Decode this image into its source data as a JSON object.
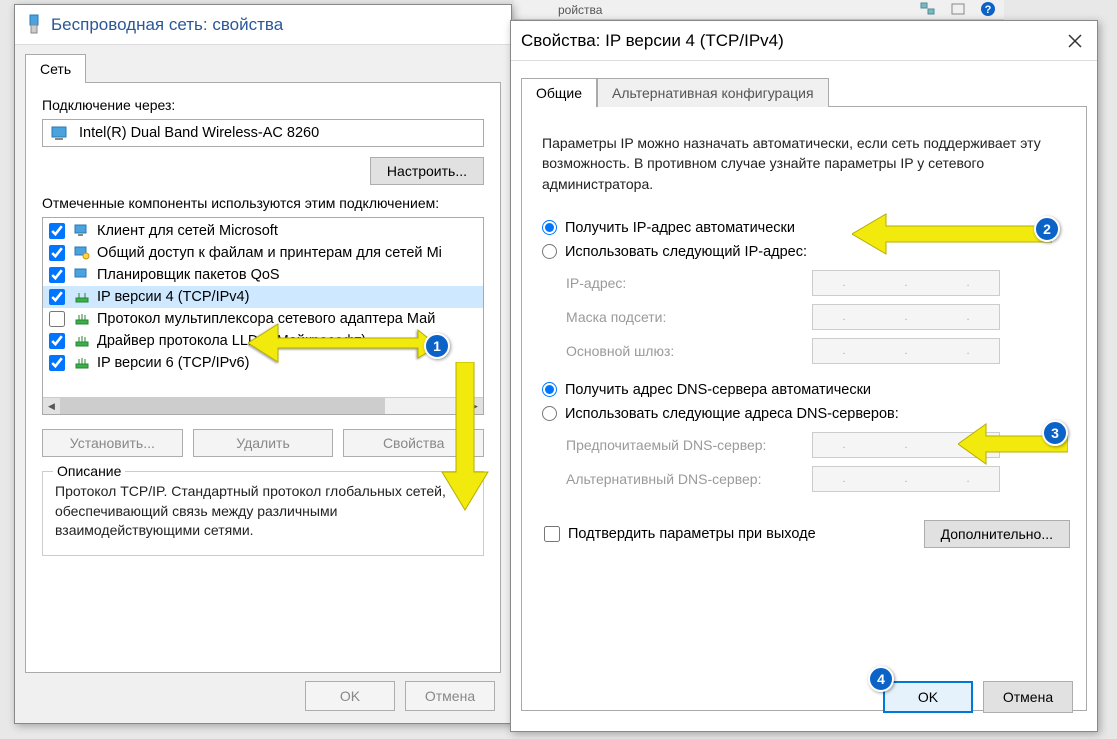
{
  "topbar": {
    "text": "ройства"
  },
  "win1": {
    "title": "Беспроводная сеть: свойства",
    "tab": "Сеть",
    "connect_label": "Подключение через:",
    "adapter": "Intel(R) Dual Band Wireless-AC 8260",
    "configure_btn": "Настроить...",
    "components_label": "Отмеченные компоненты используются этим подключением:",
    "items": [
      {
        "checked": true,
        "label": "Клиент для сетей Microsoft",
        "icon": "client"
      },
      {
        "checked": true,
        "label": "Общий доступ к файлам и принтерам для сетей Mi",
        "icon": "share"
      },
      {
        "checked": true,
        "label": "Планировщик пакетов QoS",
        "icon": "qos"
      },
      {
        "checked": true,
        "label": "IP версии 4 (TCP/IPv4)",
        "icon": "ip",
        "selected": true
      },
      {
        "checked": false,
        "label": "Протокол мультиплексора сетевого адаптера Май",
        "icon": "proto"
      },
      {
        "checked": true,
        "label": "Драйвер протокола LLDP (Майкрософт)",
        "icon": "proto"
      },
      {
        "checked": true,
        "label": "IP версии 6 (TCP/IPv6)",
        "icon": "proto"
      }
    ],
    "install_btn": "Установить...",
    "remove_btn": "Удалить",
    "props_btn": "Свойства",
    "desc_legend": "Описание",
    "desc_text": "Протокол TCP/IP. Стандартный протокол глобальных сетей, обеспечивающий связь между различными взаимодействующими сетями.",
    "ok_btn": "OK",
    "cancel_btn": "Отмена"
  },
  "win2": {
    "title": "Свойства: IP версии 4 (TCP/IPv4)",
    "tab_general": "Общие",
    "tab_alt": "Альтернативная конфигурация",
    "info": "Параметры IP можно назначать автоматически, если сеть поддерживает эту возможность. В противном случае узнайте параметры IP у сетевого администратора.",
    "radio_ip_auto": "Получить IP-адрес автоматически",
    "radio_ip_manual": "Использовать следующий IP-адрес:",
    "ip_label": "IP-адрес:",
    "mask_label": "Маска подсети:",
    "gw_label": "Основной шлюз:",
    "radio_dns_auto": "Получить адрес DNS-сервера автоматически",
    "radio_dns_manual": "Использовать следующие адреса DNS-серверов:",
    "dns1_label": "Предпочитаемый DNS-сервер:",
    "dns2_label": "Альтернативный DNS-сервер:",
    "confirm_check": "Подтвердить параметры при выходе",
    "advanced_btn": "Дополнительно...",
    "ok_btn": "OK",
    "cancel_btn": "Отмена"
  },
  "badges": {
    "b1": "1",
    "b2": "2",
    "b3": "3",
    "b4": "4"
  }
}
